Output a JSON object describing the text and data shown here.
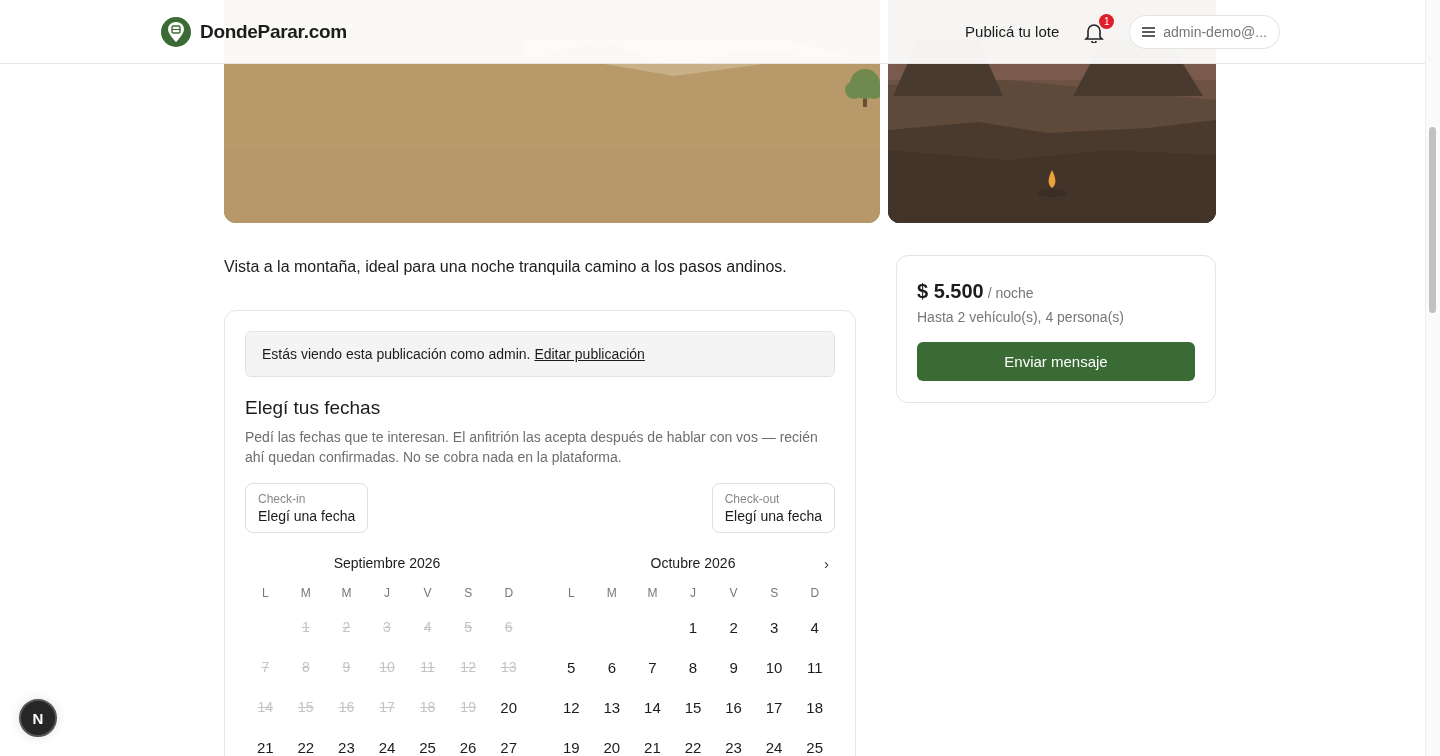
{
  "header": {
    "logo_text": "DondeParar.com",
    "publish_link": "Publicá tu lote",
    "notification_count": "1",
    "account_label": "admin-demo@..."
  },
  "description": "Vista a la montaña, ideal para una noche tranquila camino a los pasos andinos.",
  "booking": {
    "admin_notice": {
      "text": "Estás viendo esta publicación como admin.",
      "link": "Editar publicación"
    },
    "title": "Elegí tus fechas",
    "help": "Pedí las fechas que te interesan. El anfitrión las acepta después de hablar con vos — recién ahí quedan confirmadas. No se cobra nada en la plataforma.",
    "check_in": {
      "label": "Check-in",
      "value": "Elegí una fecha"
    },
    "check_out": {
      "label": "Check-out",
      "value": "Elegí una fecha"
    },
    "next_button": "›",
    "months": [
      {
        "title": "Septiembre 2026",
        "weekdays": [
          "L",
          "M",
          "M",
          "J",
          "V",
          "S",
          "D"
        ],
        "days": [
          {
            "kind": "blank"
          },
          {
            "kind": "day",
            "day": "1",
            "disabled": true
          },
          {
            "kind": "day",
            "day": "2",
            "disabled": true
          },
          {
            "kind": "day",
            "day": "3",
            "disabled": true
          },
          {
            "kind": "day",
            "day": "4",
            "disabled": true
          },
          {
            "kind": "day",
            "day": "5",
            "disabled": true
          },
          {
            "kind": "day",
            "day": "6",
            "disabled": true
          },
          {
            "kind": "day",
            "day": "7",
            "disabled": true
          },
          {
            "kind": "day",
            "day": "8",
            "disabled": true
          },
          {
            "kind": "day",
            "day": "9",
            "disabled": true
          },
          {
            "kind": "day",
            "day": "10",
            "disabled": true
          },
          {
            "kind": "day",
            "day": "11",
            "disabled": true
          },
          {
            "kind": "day",
            "day": "12",
            "disabled": true
          },
          {
            "kind": "day",
            "day": "13",
            "disabled": true
          },
          {
            "kind": "day",
            "day": "14",
            "disabled": true
          },
          {
            "kind": "day",
            "day": "15",
            "disabled": true
          },
          {
            "kind": "day",
            "day": "16",
            "disabled": true
          },
          {
            "kind": "day",
            "day": "17",
            "disabled": true
          },
          {
            "kind": "day",
            "day": "18",
            "disabled": true
          },
          {
            "kind": "day",
            "day": "19",
            "disabled": true
          },
          {
            "kind": "day",
            "day": "20",
            "disabled": false
          },
          {
            "kind": "day",
            "day": "21",
            "disabled": false
          },
          {
            "kind": "day",
            "day": "22",
            "disabled": false
          },
          {
            "kind": "day",
            "day": "23",
            "disabled": false
          },
          {
            "kind": "day",
            "day": "24",
            "disabled": false
          },
          {
            "kind": "day",
            "day": "25",
            "disabled": false
          },
          {
            "kind": "day",
            "day": "26",
            "disabled": false
          },
          {
            "kind": "day",
            "day": "27",
            "disabled": false
          }
        ]
      },
      {
        "title": "Octubre 2026",
        "weekdays": [
          "L",
          "M",
          "M",
          "J",
          "V",
          "S",
          "D"
        ],
        "days": [
          {
            "kind": "blank"
          },
          {
            "kind": "blank"
          },
          {
            "kind": "blank"
          },
          {
            "kind": "day",
            "day": "1",
            "disabled": false
          },
          {
            "kind": "day",
            "day": "2",
            "disabled": false
          },
          {
            "kind": "day",
            "day": "3",
            "disabled": false
          },
          {
            "kind": "day",
            "day": "4",
            "disabled": false
          },
          {
            "kind": "day",
            "day": "5",
            "disabled": false
          },
          {
            "kind": "day",
            "day": "6",
            "disabled": false
          },
          {
            "kind": "day",
            "day": "7",
            "disabled": false
          },
          {
            "kind": "day",
            "day": "8",
            "disabled": false
          },
          {
            "kind": "day",
            "day": "9",
            "disabled": false
          },
          {
            "kind": "day",
            "day": "10",
            "disabled": false
          },
          {
            "kind": "day",
            "day": "11",
            "disabled": false
          },
          {
            "kind": "day",
            "day": "12",
            "disabled": false
          },
          {
            "kind": "day",
            "day": "13",
            "disabled": false
          },
          {
            "kind": "day",
            "day": "14",
            "disabled": false
          },
          {
            "kind": "day",
            "day": "15",
            "disabled": false
          },
          {
            "kind": "day",
            "day": "16",
            "disabled": false
          },
          {
            "kind": "day",
            "day": "17",
            "disabled": false
          },
          {
            "kind": "day",
            "day": "18",
            "disabled": false
          },
          {
            "kind": "day",
            "day": "19",
            "disabled": false
          },
          {
            "kind": "day",
            "day": "20",
            "disabled": false
          },
          {
            "kind": "day",
            "day": "21",
            "disabled": false
          },
          {
            "kind": "day",
            "day": "22",
            "disabled": false
          },
          {
            "kind": "day",
            "day": "23",
            "disabled": false
          },
          {
            "kind": "day",
            "day": "24",
            "disabled": false
          },
          {
            "kind": "day",
            "day": "25",
            "disabled": false
          }
        ]
      }
    ]
  },
  "price_card": {
    "price": "$ 5.500",
    "unit": "/ noche",
    "capacity": "Hasta 2 vehículo(s), 4 persona(s)",
    "button": "Enviar mensaje"
  },
  "dev_badge": "N"
}
